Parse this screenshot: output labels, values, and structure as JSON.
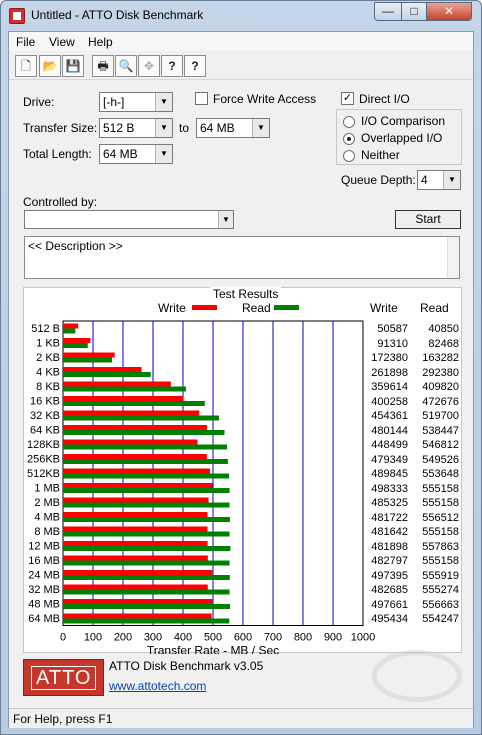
{
  "window": {
    "title": "Untitled - ATTO Disk Benchmark",
    "min_glyph": "—",
    "max_glyph": "□",
    "close_glyph": "✕"
  },
  "menu": [
    "File",
    "View",
    "Help"
  ],
  "toolbar": {
    "icons": [
      "new-icon",
      "open-icon",
      "save-icon",
      "print-icon",
      "print-preview-icon",
      "move-icon",
      "help-icon",
      "context-help-icon"
    ],
    "glyphs": [
      "🗋",
      "📂",
      "💾",
      "🖶",
      "🔍",
      "✥",
      "?",
      "?"
    ]
  },
  "form": {
    "drive_label": "Drive:",
    "drive_value": "[-h-]",
    "force_write_label": "Force Write Access",
    "direct_io_label": "Direct I/O",
    "direct_io_checked": true,
    "transfer_size_label": "Transfer Size:",
    "transfer_from": "512 B",
    "to_label": "to",
    "transfer_to": "64 MB",
    "total_length_label": "Total Length:",
    "total_length": "64 MB",
    "io_comparison_label": "I/O Comparison",
    "overlapped_io_label": "Overlapped I/O",
    "neither_label": "Neither",
    "queue_depth_label": "Queue Depth:",
    "queue_depth": "4",
    "controlled_by_label": "Controlled by:",
    "start_label": "Start",
    "description": "<< Description >>"
  },
  "results": {
    "title": "Test Results",
    "write_legend": "Write",
    "read_legend": "Read",
    "write_col": "Write",
    "read_col": "Read",
    "write_color": "#ff0000",
    "read_color": "#008000",
    "grid_color": "#0000cc"
  },
  "chart_data": {
    "type": "bar",
    "orientation": "horizontal",
    "xlabel": "Transfer Rate - MB / Sec",
    "xlim": [
      0,
      1000
    ],
    "xticks": [
      0,
      100,
      200,
      300,
      400,
      500,
      600,
      700,
      800,
      900,
      1000
    ],
    "categories": [
      "512 B",
      "1 KB",
      "2 KB",
      "4 KB",
      "8 KB",
      "16 KB",
      "32 KB",
      "64 KB",
      "128KB",
      "256KB",
      "512KB",
      "1 MB",
      "2 MB",
      "4 MB",
      "8 MB",
      "12 MB",
      "16 MB",
      "24 MB",
      "32 MB",
      "48 MB",
      "64 MB"
    ],
    "series": [
      {
        "name": "Write",
        "color": "#ff0000",
        "values": [
          50587,
          91310,
          172380,
          261898,
          359614,
          400258,
          454361,
          480144,
          448499,
          479349,
          489845,
          498333,
          485325,
          481722,
          481642,
          481898,
          482797,
          497395,
          482685,
          497661,
          495434
        ]
      },
      {
        "name": "Read",
        "color": "#008000",
        "values": [
          40850,
          82468,
          163282,
          292380,
          409820,
          472676,
          519700,
          538447,
          546812,
          549526,
          553648,
          555158,
          555158,
          556512,
          555158,
          557863,
          555158,
          555919,
          555274,
          556663,
          554247
        ]
      }
    ],
    "value_unit": "KB/s"
  },
  "footer": {
    "logo": "ATTO",
    "version": "ATTO Disk Benchmark v3.05",
    "url": "www.attotech.com"
  },
  "status": "For Help, press F1"
}
